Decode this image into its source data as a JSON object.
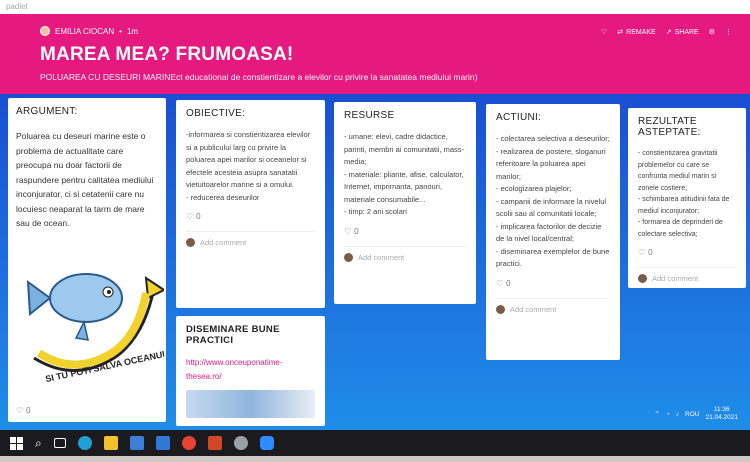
{
  "app": {
    "brand": "padlet"
  },
  "header": {
    "author": "EMILIA CIOCAN",
    "time": "1m",
    "title": "MAREA MEA? FRUMOASA!",
    "subtitle": "POLUAREA CU DESEURI MARINEct educational de constientizare a elevilor cu privire la sanatatea mediului marin)",
    "remake": "REMAKE",
    "share": "SHARE",
    "color": "#e5197f"
  },
  "cards": {
    "argument": {
      "title": "ARGUMENT:",
      "text": "Poluarea cu deseuri marine este o problema de actualitate care preocupa nu doar factorii de raspundere pentru calitatea mediului inconjurator, ci si cetatenii care nu locuiesc neaparat la tarm de mare sau de ocean.",
      "image_text": "SI TU POTI SALVA OCEANUL",
      "likes": "0"
    },
    "objective": {
      "title": "OBIECTIVE:",
      "lines": [
        "-informarea si constientizarea elevilor si a publicului larg cu privire la poluarea apei marilor si oceanelor si efectele acesteia asupra sanatatii vietuitoarelor marine si a omului.",
        "- reducerea deseurilor"
      ],
      "likes": "0",
      "comment": "Add comment"
    },
    "resources": {
      "title": "RESURSE",
      "lines": [
        "- umane: elevi, cadre didactice, parinti, membri ai comunitatii, mass-media;",
        "- materiale: pliante, afise, calculator, Internet, imprimanta, panouri, materiale consumabile...",
        "- timp: 2 ani scolari"
      ],
      "likes": "0",
      "comment": "Add comment"
    },
    "actions": {
      "title": "ACTIUNI:",
      "lines": [
        "- colectarea selectiva a deseurilor;",
        "- realizarea de postere, sloganuri referitoare la poluarea apei marilor;",
        "- ecologizarea plajelor;",
        "- campanii de informare la nivelul scolii sau al comunitatii locale;",
        "- implicarea factorilor de decizie de la nivel local/central;",
        "- diseminarea exemplelor de bune practici."
      ],
      "likes": "0",
      "comment": "Add comment"
    },
    "results": {
      "title": "REZULTATE ASTEPTATE:",
      "lines": [
        "- constientizarea gravitatii problemelor cu care se confrunta mediul marin si zonele costiere;",
        "- schimbarea atitudinii fata de mediul inconjurator;",
        "- formarea de deprinderi de colectare selectiva;"
      ],
      "likes": "0",
      "comment": "Add comment"
    },
    "dissemination": {
      "title": "DISEMINARE BUNE PRACTICI",
      "link": "http://www.onceuponatime-thesea.ro/"
    }
  },
  "system": {
    "lang": "ROU",
    "time": "11:36",
    "date": "21.04.2021"
  },
  "colors": {
    "board_top": "#1a4fd1",
    "board_bottom": "#1f8de8",
    "fab": "#e5197f"
  }
}
